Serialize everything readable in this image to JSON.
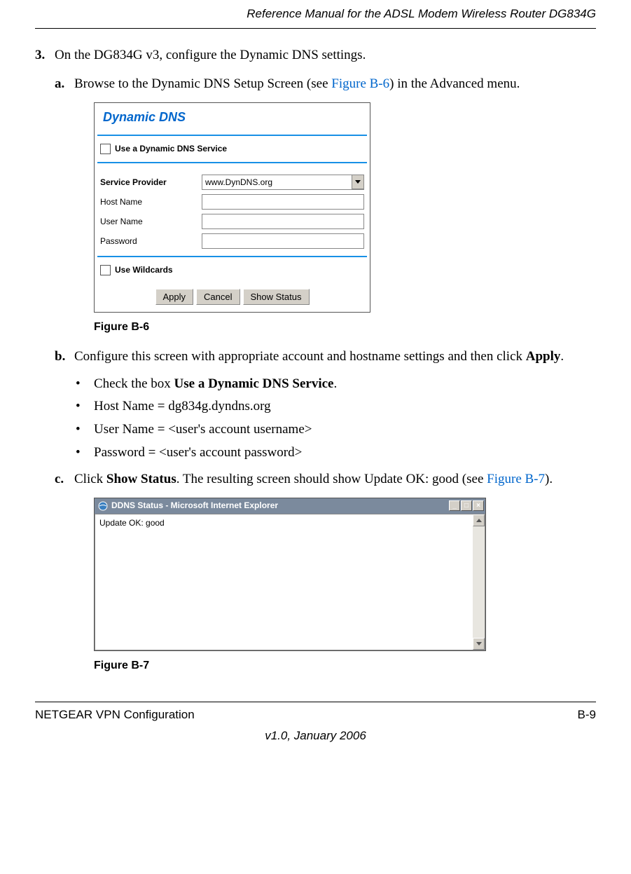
{
  "header": {
    "title": "Reference Manual for the ADSL Modem Wireless Router DG834G"
  },
  "step3": {
    "number": "3.",
    "text": "On the DG834G v3, configure the Dynamic DNS settings."
  },
  "sub_a": {
    "letter": "a.",
    "pre": "Browse to the Dynamic DNS Setup Screen (see ",
    "link": "Figure B-6",
    "post": ") in the Advanced menu."
  },
  "figure_b6": {
    "caption": "Figure B-6",
    "panel_title": "Dynamic DNS",
    "use_ddns_label": "Use a Dynamic DNS Service",
    "service_provider_label": "Service Provider",
    "service_provider_value": "www.DynDNS.org",
    "host_name_label": "Host Name",
    "user_name_label": "User Name",
    "password_label": "Password",
    "use_wildcards_label": "Use Wildcards",
    "apply_btn": "Apply",
    "cancel_btn": "Cancel",
    "show_status_btn": "Show Status"
  },
  "sub_b": {
    "letter": "b.",
    "text_pre": "Configure this screen with appropriate account and hostname settings and then click ",
    "text_bold": "Apply",
    "text_post": ".",
    "bullets": {
      "b1_pre": "Check the box ",
      "b1_bold": "Use a Dynamic DNS Service",
      "b1_post": ".",
      "b2": "Host Name = dg834g.dyndns.org",
      "b3": "User Name = <user's account username>",
      "b4": "Password = <user's account password>"
    }
  },
  "sub_c": {
    "letter": "c.",
    "pre": "Click ",
    "bold": "Show Status",
    "mid": ". The resulting screen should show Update OK: good (see ",
    "link": "Figure B-7",
    "post": ")."
  },
  "figure_b7": {
    "caption": "Figure B-7",
    "window_title": "DDNS Status - Microsoft Internet Explorer",
    "body_text": "Update OK: good",
    "min_symbol": "_",
    "max_symbol": "□",
    "close_symbol": "×",
    "ie_glyph": "e"
  },
  "footer": {
    "left": "NETGEAR VPN Configuration",
    "right": "B-9",
    "center": "v1.0, January 2006"
  }
}
